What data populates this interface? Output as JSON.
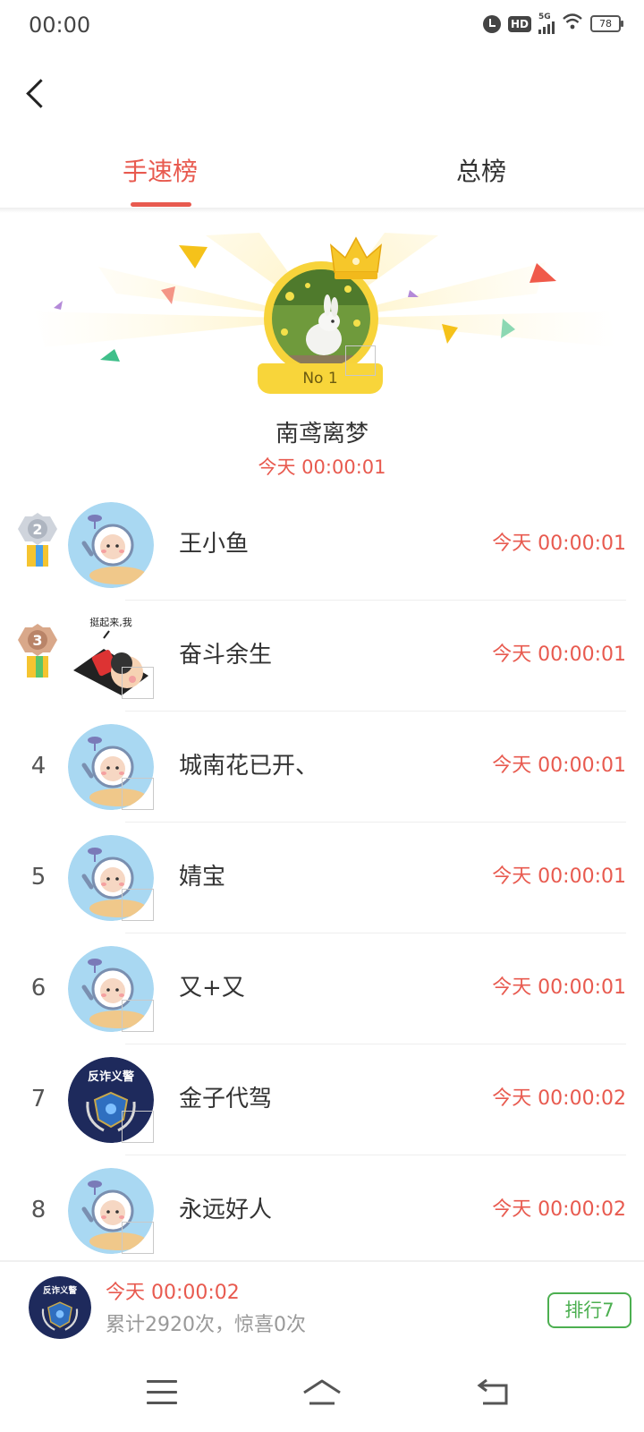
{
  "status": {
    "time": "00:00",
    "hd": "HD",
    "network": "5G",
    "battery": "78"
  },
  "tabs": [
    {
      "label": "手速榜"
    },
    {
      "label": "总榜"
    }
  ],
  "champion": {
    "badge": "No 1",
    "name": "南鸢离梦",
    "time": "今天 00:00:01"
  },
  "rankings": [
    {
      "rank": "2",
      "name": "王小鱼",
      "time": "今天 00:00:01",
      "avatar": "astronaut"
    },
    {
      "rank": "3",
      "name": "奋斗余生",
      "time": "今天 00:00:01",
      "avatar": "cartoon-doll",
      "avatar_text": "挺起来,我"
    },
    {
      "rank": "4",
      "name": "城南花已开、",
      "time": "今天 00:00:01",
      "avatar": "astronaut"
    },
    {
      "rank": "5",
      "name": "婧宝",
      "time": "今天 00:00:01",
      "avatar": "astronaut"
    },
    {
      "rank": "6",
      "name": "又+又",
      "time": "今天 00:00:01",
      "avatar": "astronaut"
    },
    {
      "rank": "7",
      "name": "金子代驾",
      "time": "今天 00:00:02",
      "avatar": "police-badge",
      "avatar_text": "反诈义警"
    },
    {
      "rank": "8",
      "name": "永远好人",
      "time": "今天 00:00:02",
      "avatar": "astronaut"
    }
  ],
  "me": {
    "time": "今天 00:00:02",
    "stats": "累计2920次，惊喜0次",
    "rank_label": "排行7",
    "avatar_text": "反诈义警"
  },
  "colors": {
    "accent": "#e85a4f",
    "gold": "#f7d33a",
    "green": "#4caf50"
  }
}
